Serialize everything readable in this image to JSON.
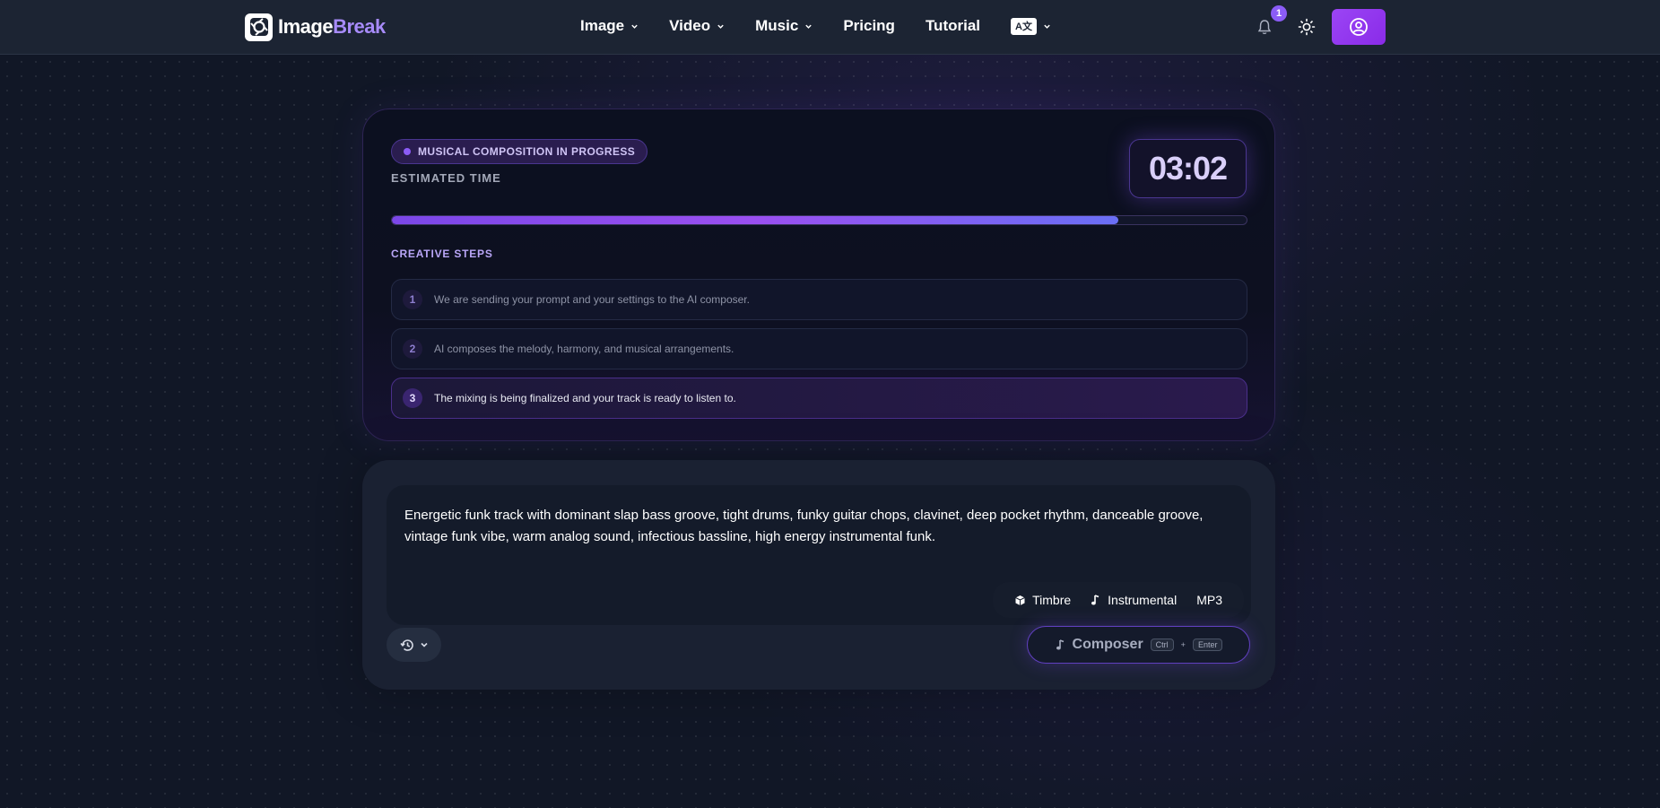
{
  "nav": {
    "logo_a": "Image",
    "logo_b": "Break",
    "items": [
      {
        "label": "Image",
        "dropdown": true
      },
      {
        "label": "Video",
        "dropdown": true
      },
      {
        "label": "Music",
        "dropdown": true
      },
      {
        "label": "Pricing",
        "dropdown": false
      },
      {
        "label": "Tutorial",
        "dropdown": false
      }
    ],
    "language_icon": "translate-icon",
    "notification_count": "1",
    "accent_color": "#8b5cf6"
  },
  "progress": {
    "status": "MUSICAL COMPOSITION IN PROGRESS",
    "estimated_label": "ESTIMATED TIME",
    "timer": "03:02",
    "progress_fraction": 0.85,
    "steps_title": "CREATIVE STEPS",
    "steps": [
      {
        "num": "1",
        "text": "We are sending your prompt and your settings to the AI composer.",
        "active": false
      },
      {
        "num": "2",
        "text": "AI composes the melody, harmony, and musical arrangements.",
        "active": false
      },
      {
        "num": "3",
        "text": "The mixing is being finalized and your track is ready to listen to.",
        "active": true
      }
    ]
  },
  "prompt": {
    "text": "Energetic funk track with dominant slap bass groove, tight drums, funky guitar chops, clavinet, deep pocket rhythm, danceable groove, vintage funk vibe, warm analog sound, infectious bassline, high energy instrumental funk.",
    "options": {
      "timbre": "Timbre",
      "instrumental": "Instrumental",
      "format": "MP3"
    },
    "compose_label": "Composer",
    "kbd_ctrl": "Ctrl",
    "kbd_plus": "+",
    "kbd_enter": "Enter"
  }
}
